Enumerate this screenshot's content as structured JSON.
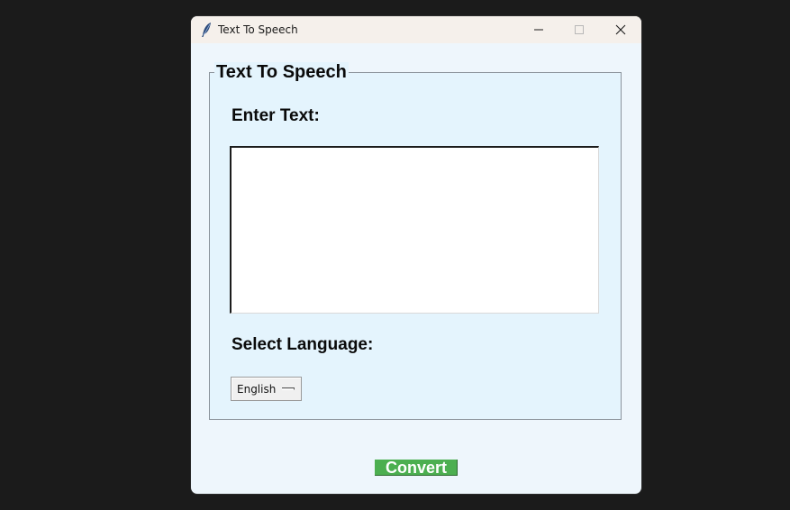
{
  "window": {
    "title": "Text To Speech"
  },
  "frame": {
    "legend": "Text To Speech"
  },
  "text_input": {
    "label": "Enter Text:",
    "value": ""
  },
  "language": {
    "label": "Select Language:",
    "selected": "English"
  },
  "actions": {
    "convert_label": "Convert"
  },
  "colors": {
    "window_background": "#eef6fc",
    "frame_background": "#e4f4fd",
    "convert_button": "#4caf50",
    "titlebar": "#f5f0eb"
  },
  "icons": {
    "app": "feather-icon",
    "minimize": "minimize-icon",
    "maximize": "maximize-icon",
    "close": "close-icon"
  }
}
